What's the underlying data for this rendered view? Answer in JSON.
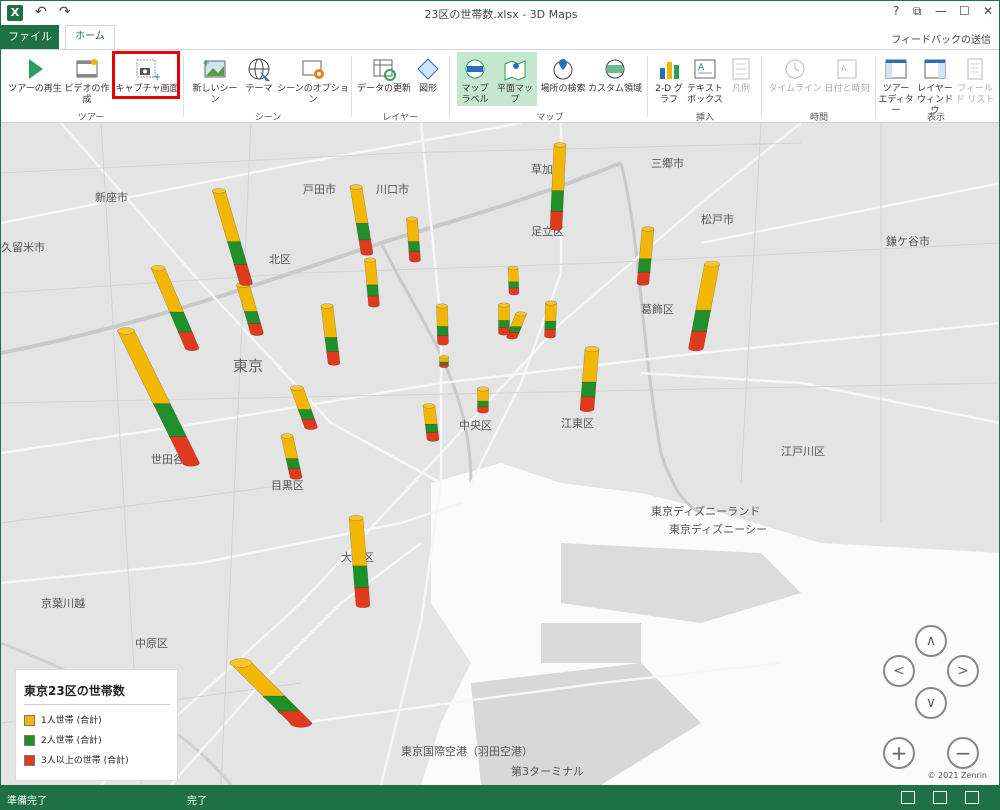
{
  "window": {
    "title": "23区の世帯数.xlsx - 3D Maps",
    "help": "?",
    "restore": "⧉",
    "min": "—",
    "max": "☐",
    "close": "✕",
    "undo": "↶",
    "redo": "↷",
    "app_icon": "X"
  },
  "tabs": {
    "file": "ファイル",
    "home": "ホーム",
    "feedback": "フィードバックの送信"
  },
  "ribbon": {
    "buttons": [
      {
        "id": "play",
        "label": "ツアーの再生",
        "icon": "play-icon"
      },
      {
        "id": "video",
        "label": "ビデオの作成",
        "icon": "film-icon"
      },
      {
        "id": "capture",
        "label": "キャプチャ画面",
        "icon": "camera-icon"
      },
      {
        "id": "new_scene",
        "label": "新しいシーン",
        "icon": "new-scene-icon"
      },
      {
        "id": "theme",
        "label": "テーマ",
        "icon": "globe-theme-icon"
      },
      {
        "id": "scene_options",
        "label": "シーンのオプション",
        "icon": "gear-scene-icon"
      },
      {
        "id": "refresh",
        "label": "データの更新",
        "icon": "refresh-icon"
      },
      {
        "id": "shapes",
        "label": "図形",
        "icon": "shape-icon"
      },
      {
        "id": "map_labels",
        "label": "マップ ラベル",
        "icon": "map-labels-icon"
      },
      {
        "id": "flat_map",
        "label": "平面マップ",
        "icon": "flat-map-icon"
      },
      {
        "id": "find_location",
        "label": "場所の検索",
        "icon": "find-location-icon"
      },
      {
        "id": "custom_regions",
        "label": "カスタム領域",
        "icon": "custom-region-icon"
      },
      {
        "id": "chart2d",
        "label": "2-D グラフ",
        "icon": "bar-chart-icon"
      },
      {
        "id": "textbox",
        "label": "テキスト ボックス",
        "icon": "textbox-icon"
      },
      {
        "id": "legend",
        "label": "凡例",
        "icon": "legend-icon"
      },
      {
        "id": "timeline",
        "label": "タイムライン",
        "icon": "clock-icon"
      },
      {
        "id": "datetime",
        "label": "日付と時刻",
        "icon": "calendar-icon"
      },
      {
        "id": "tour_editor",
        "label": "ツアー エディター",
        "icon": "tour-editor-icon"
      },
      {
        "id": "layer_window",
        "label": "レイヤー ウィンドウ",
        "icon": "layer-window-icon"
      },
      {
        "id": "field_list",
        "label": "フィールド リスト",
        "icon": "field-list-icon"
      }
    ],
    "groups": [
      "ツアー",
      "シーン",
      "レイヤー",
      "マップ",
      "挿入",
      "時間",
      "表示"
    ]
  },
  "map_labels": [
    "戸田市",
    "川口市",
    "草加市",
    "三郷市",
    "松戸市",
    "新座市",
    "足立区",
    "鎌ケ谷市",
    "久留米市",
    "北区",
    "江戸川区",
    "東京",
    "中央区",
    "江東区",
    "世田谷区",
    "目黒区",
    "東京ディズニーランド",
    "東京ディズニーシー",
    "大田区",
    "東京国際空港（羽田空港）",
    "第3ターミナル",
    "中原区",
    "葛飾区",
    "京葉川越"
  ],
  "legend": {
    "title": "東京23区の世帯数",
    "items": [
      {
        "label": "1人世帯 (合計)",
        "color": "#f2b705"
      },
      {
        "label": "2人世帯 (合計)",
        "color": "#1f8f2a"
      },
      {
        "label": "3人以上の世帯 (合計)",
        "color": "#e03a1e"
      }
    ]
  },
  "nav": {
    "up": "∧",
    "left": "<",
    "right": ">",
    "down": "∨",
    "zoom_in": "+",
    "zoom_out": "−"
  },
  "copyright": "© 2021 Zenrin",
  "status": {
    "left": "準備完了",
    "center": "完了"
  }
}
